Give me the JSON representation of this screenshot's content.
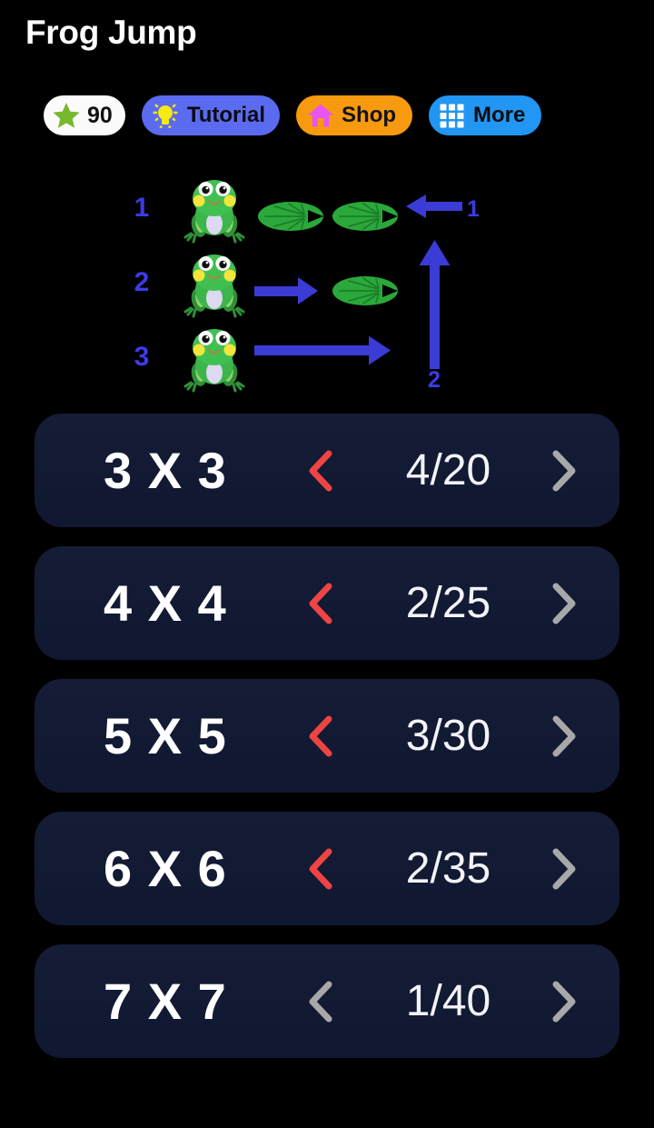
{
  "app": {
    "title": "Frog Jump",
    "background_color": "#000000"
  },
  "toolbar": {
    "score": {
      "label": "90",
      "icon": "star-icon",
      "icon_color": "#77b82f",
      "pill_color": "#fbfbfb"
    },
    "tutorial": {
      "label": "Tutorial",
      "icon": "lightbulb-icon",
      "icon_color": "#f5ea12",
      "pill_color": "#5a6bf0"
    },
    "shop": {
      "label": "Shop",
      "icon": "home-icon",
      "icon_color": "#e855f0",
      "pill_color": "#f79a10"
    },
    "more": {
      "label": "More",
      "icon": "grid-icon",
      "icon_color": "#ffffff",
      "pill_color": "#2196f3"
    }
  },
  "illustration": {
    "description": "frog-jump-diagram",
    "arrow_color": "#3b3bd6",
    "frog_color": "#3cb54a",
    "lilypad_color": "#2aa93a",
    "row_labels": [
      "1",
      "2",
      "3"
    ],
    "column_label_horizontal": "1",
    "column_label_vertical": "2",
    "rows": [
      {
        "label": "1",
        "frogs": 1,
        "lilypads": 2,
        "arrow": "left"
      },
      {
        "label": "2",
        "frogs": 1,
        "lilypads": 1,
        "arrow": "right-short"
      },
      {
        "label": "3",
        "frogs": 1,
        "lilypads": 0,
        "arrow": "right-long"
      }
    ]
  },
  "levels": {
    "chevron_active_color": "#ef4444",
    "chevron_inactive_color": "#a8a8a8",
    "rows": [
      {
        "name": "3 X 3",
        "progress": "4/20",
        "left_chevron_state": "active"
      },
      {
        "name": "4 X 4",
        "progress": "2/25",
        "left_chevron_state": "active"
      },
      {
        "name": "5 X 5",
        "progress": "3/30",
        "left_chevron_state": "active"
      },
      {
        "name": "6 X 6",
        "progress": "2/35",
        "left_chevron_state": "active"
      },
      {
        "name": "7 X 7",
        "progress": "1/40",
        "left_chevron_state": "inactive"
      }
    ]
  }
}
